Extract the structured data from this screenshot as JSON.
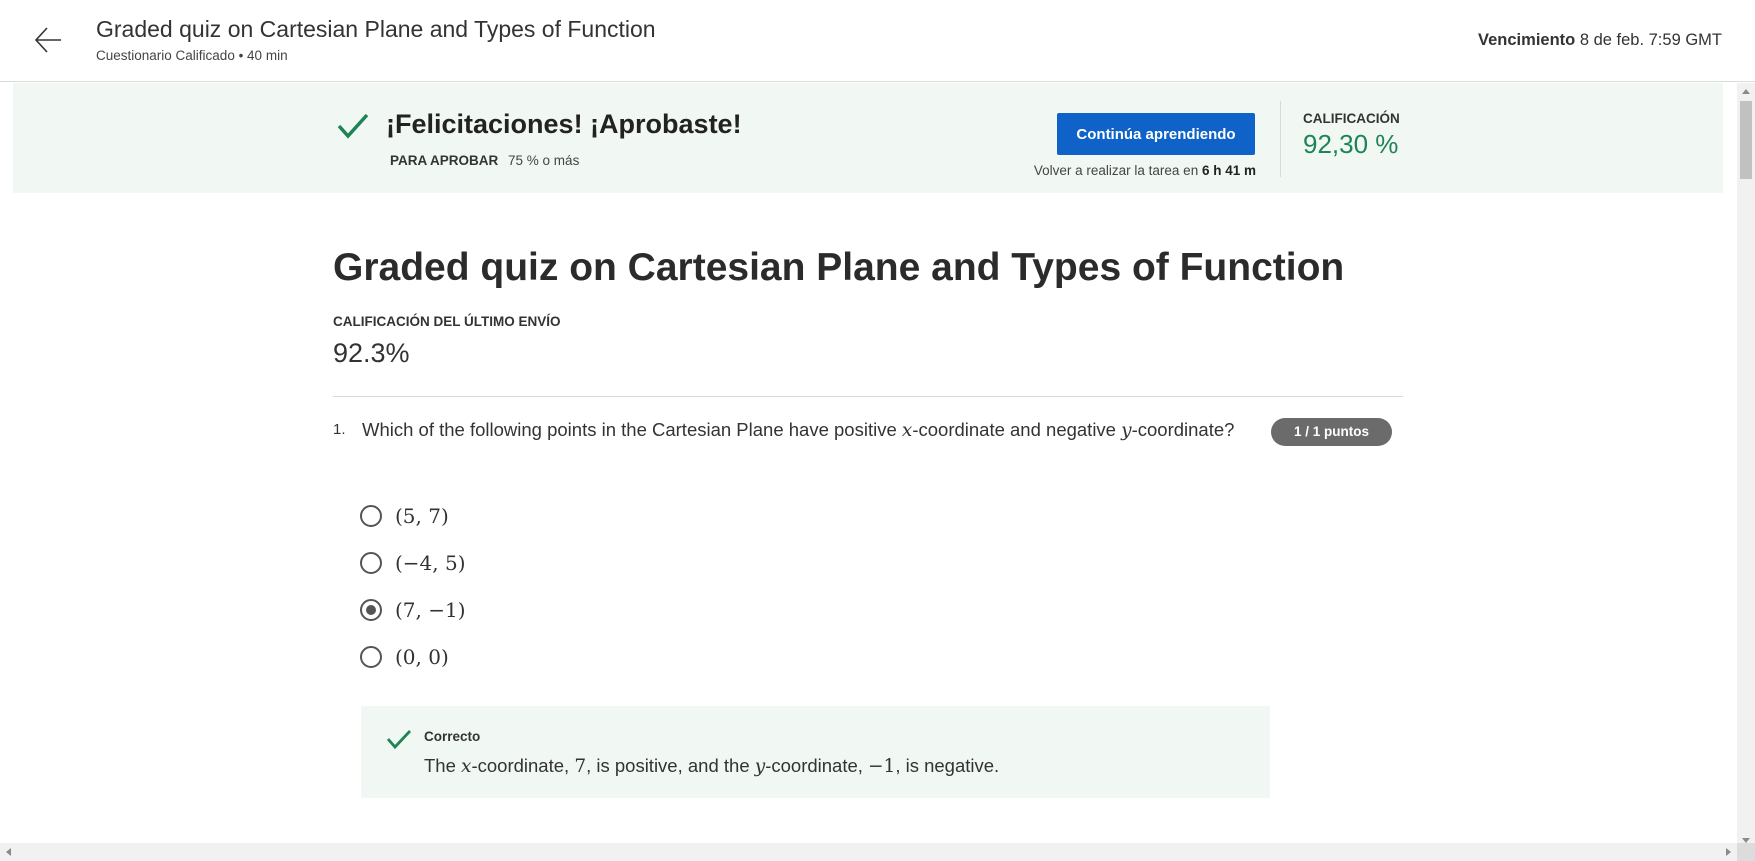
{
  "header": {
    "title": "Graded quiz on Cartesian Plane and Types of Function",
    "subtitle": "Cuestionario Calificado • 40 min",
    "due_label": "Vencimiento",
    "due_value": "8 de feb. 7:59 GMT"
  },
  "banner": {
    "title": "¡Felicitaciones! ¡Aprobaste!",
    "pass_label": "PARA APROBAR",
    "pass_value": "75 % o más",
    "continue_button": "Continúa aprendiendo",
    "retake_prefix": "Volver a realizar la tarea en",
    "retake_time": "6 h 41 m",
    "grade_label": "CALIFICACIÓN",
    "grade_value": "92,30 %"
  },
  "main": {
    "title": "Graded quiz on Cartesian Plane and Types of Function",
    "last_submission_label": "CALIFICACIÓN DEL ÚLTIMO ENVÍO",
    "last_submission_value": "92.3%"
  },
  "question": {
    "number": "1.",
    "text_part1": "Which of the following points in the Cartesian Plane have positive ",
    "var_x": "x",
    "text_part2": "-coordinate and negative ",
    "var_y": "y",
    "text_part3": "-coordinate?",
    "points": "1 / 1 puntos",
    "options": [
      {
        "label": "(5, 7)",
        "selected": false
      },
      {
        "label": "(−4, 5)",
        "selected": false
      },
      {
        "label": "(7, −1)",
        "selected": true
      },
      {
        "label": "(0, 0)",
        "selected": false
      }
    ],
    "feedback": {
      "title": "Correcto",
      "part1": "The ",
      "var_x": "x",
      "part2": "-coordinate, ",
      "num1": "7",
      "part3": ", is positive, and the ",
      "var_y": "y",
      "part4": "-coordinate, ",
      "num2": "−1",
      "part5": ", is negative."
    }
  },
  "colors": {
    "accent_blue": "#0f62c8",
    "success_green": "#1f8354",
    "banner_bg": "#f1f8f4",
    "badge_gray": "#6b6b6b"
  },
  "icons": {
    "back": "arrow-left-icon",
    "success": "check-icon"
  }
}
